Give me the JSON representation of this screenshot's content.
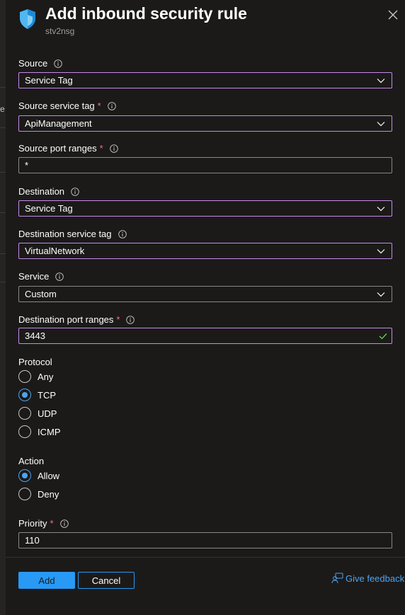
{
  "header": {
    "title": "Add inbound security rule",
    "subtitle": "stv2nsg"
  },
  "fields": {
    "source": {
      "label": "Source",
      "value": "Service Tag"
    },
    "source_service_tag": {
      "label": "Source service tag",
      "required": "*",
      "value": "ApiManagement"
    },
    "source_port_ranges": {
      "label": "Source port ranges",
      "required": "*",
      "value": "*"
    },
    "destination": {
      "label": "Destination",
      "value": "Service Tag"
    },
    "destination_service_tag": {
      "label": "Destination service tag",
      "value": "VirtualNetwork"
    },
    "service": {
      "label": "Service",
      "value": "Custom"
    },
    "destination_port_ranges": {
      "label": "Destination port ranges",
      "required": "*",
      "value": "3443"
    },
    "priority": {
      "label": "Priority",
      "required": "*",
      "value": "110"
    }
  },
  "protocol": {
    "label": "Protocol",
    "options": [
      "Any",
      "TCP",
      "UDP",
      "ICMP"
    ],
    "selected": "TCP"
  },
  "action": {
    "label": "Action",
    "options": [
      "Allow",
      "Deny"
    ],
    "selected": "Allow"
  },
  "footer": {
    "add_label": "Add",
    "cancel_label": "Cancel",
    "feedback_label": "Give feedback"
  },
  "background": {
    "glyph": "e"
  },
  "icons": {
    "header": "shield-icon",
    "close": "close-icon",
    "info": "info-icon",
    "dropdown": "chevron-down-icon",
    "valid": "checkmark-icon",
    "feedback": "feedback-person-icon"
  },
  "colors": {
    "panel_bg": "#1b1a19",
    "focus_border": "#c58ae8",
    "accent": "#2899f5",
    "link": "#4da3f0",
    "required": "#f1707b",
    "valid": "#6ccb5f"
  }
}
